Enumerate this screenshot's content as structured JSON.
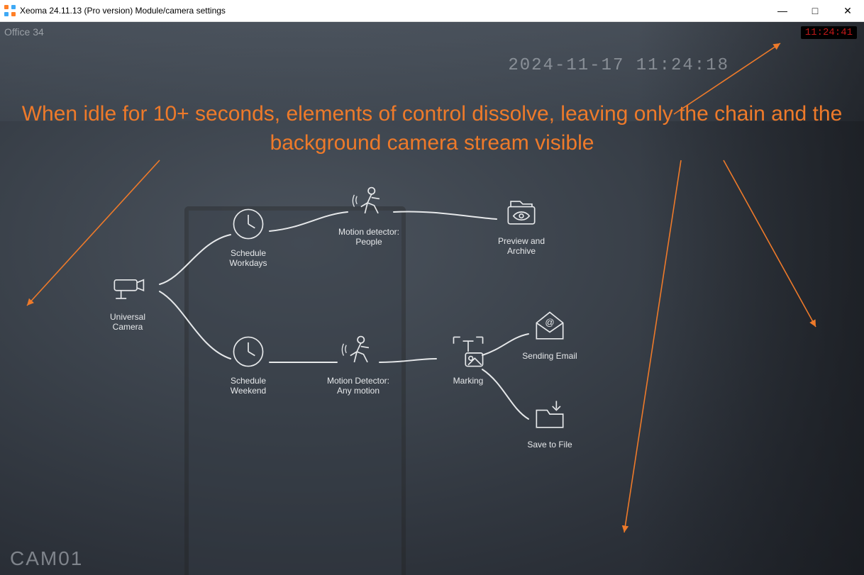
{
  "window": {
    "title": "Xeoma 24.11.13 (Pro version) Module/camera settings",
    "min": "—",
    "max": "□",
    "close": "✕"
  },
  "overlay": {
    "camera_name": "Office 34",
    "clock": "11:24:41",
    "stream_timestamp": "2024-11-17 11:24:18",
    "camera_id": "CAM01"
  },
  "annotation": {
    "text": "When idle for 10+ seconds,  elements of control dissolve, leaving only the chain and the background camera stream visible"
  },
  "modules": {
    "universal_camera": "Universal Camera",
    "schedule_workdays": "Schedule Workdays",
    "schedule_weekend": "Schedule Weekend",
    "motion_people": "Motion detector: People",
    "motion_any": "Motion Detector: Any motion",
    "preview_archive": "Preview and Archive",
    "marking": "Marking",
    "sending_email": "Sending Email",
    "save_to_file": "Save to File"
  }
}
